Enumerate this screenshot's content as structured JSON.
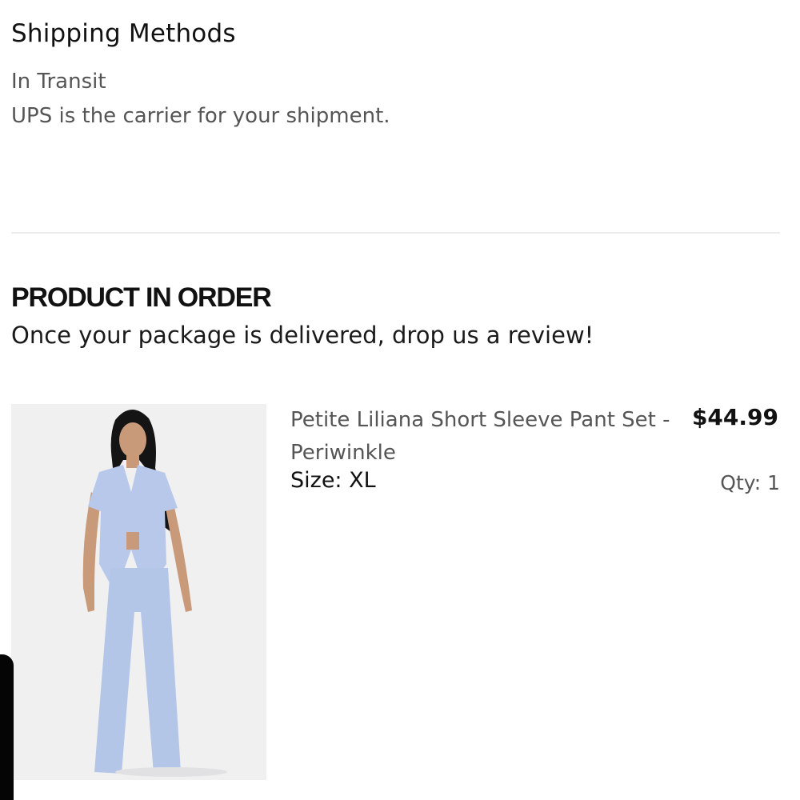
{
  "shipping": {
    "title": "Shipping Methods",
    "status": "In Transit",
    "carrier_text": "UPS is the carrier for your shipment."
  },
  "order": {
    "heading": "PRODUCT IN ORDER",
    "subtext": "Once your package is delivered, drop us a review!",
    "product": {
      "name": "Petite Liliana Short Sleeve Pant Set - Periwinkle",
      "price": "$44.99",
      "size": "Size: XL",
      "qty": "Qty: 1",
      "color": "#b9c9ea"
    }
  }
}
